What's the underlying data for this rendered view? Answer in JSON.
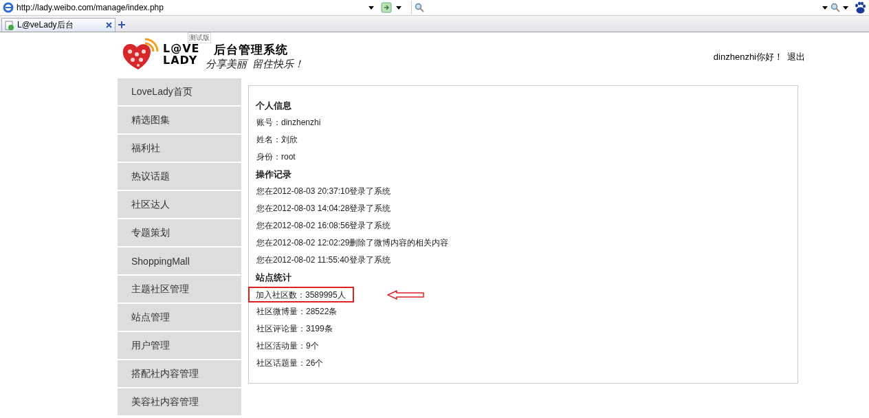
{
  "browser": {
    "address": "http://lady.weibo.com/manage/index.php",
    "tabs": [
      {
        "title": "L@veLady后台",
        "selected": true
      }
    ]
  },
  "header": {
    "logo_top": "L@VE",
    "logo_bottom": "LADY",
    "badge": "测试版",
    "title": "后台管理系统",
    "slogan": "分享美丽  留住快乐！",
    "greeting": "dinzhenzhi你好！",
    "logout": "退出"
  },
  "sidebar": {
    "items": [
      {
        "label": "LoveLady首页"
      },
      {
        "label": "精选图集"
      },
      {
        "label": "福利社"
      },
      {
        "label": "热议话题"
      },
      {
        "label": "社区达人"
      },
      {
        "label": "专题策划"
      },
      {
        "label": "ShoppingMall"
      },
      {
        "label": "主题社区管理"
      },
      {
        "label": "站点管理"
      },
      {
        "label": "用户管理"
      },
      {
        "label": "搭配社内容管理"
      },
      {
        "label": "美容社内容管理"
      }
    ]
  },
  "sections": [
    {
      "heading": "个人信息",
      "lines": [
        {
          "text": "账号：dinzhenzhi",
          "highlighted": false
        },
        {
          "text": "姓名：刘欣",
          "highlighted": false
        },
        {
          "text": "身份：root",
          "highlighted": false
        }
      ]
    },
    {
      "heading": "操作记录",
      "lines": [
        {
          "text": "您在2012-08-03 20:37:10登录了系统",
          "highlighted": false
        },
        {
          "text": "您在2012-08-03 14:04:28登录了系统",
          "highlighted": false
        },
        {
          "text": "您在2012-08-02 16:08:56登录了系统",
          "highlighted": false
        },
        {
          "text": "您在2012-08-02 12:02:29删除了微博内容的相关内容",
          "highlighted": false
        },
        {
          "text": "您在2012-08-02 11:55:40登录了系统",
          "highlighted": false
        }
      ]
    },
    {
      "heading": "站点统计",
      "lines": [
        {
          "text": "加入社区数：3589995人",
          "highlighted": true
        },
        {
          "text": "社区微博量：28522条",
          "highlighted": false
        },
        {
          "text": "社区评论量：3199条",
          "highlighted": false
        },
        {
          "text": "社区活动量：9个",
          "highlighted": false
        },
        {
          "text": "社区话题量：26个",
          "highlighted": false
        }
      ]
    }
  ]
}
